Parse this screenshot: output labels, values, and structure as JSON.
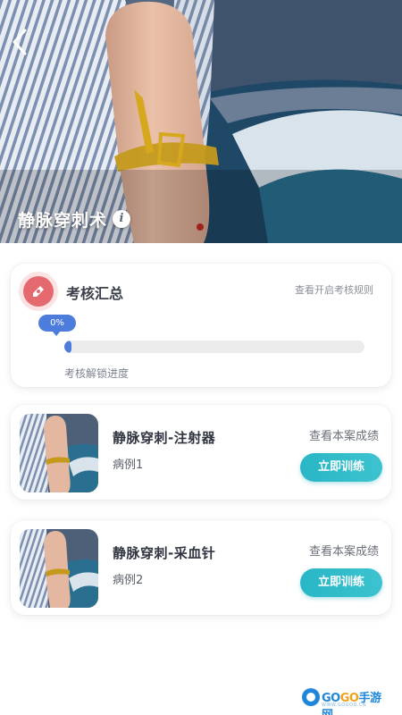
{
  "hero": {
    "title": "静脉穿刺术",
    "back_icon": "chevron-left-icon",
    "info_icon": "info-icon",
    "info_glyph": "i"
  },
  "summary": {
    "title": "考核汇总",
    "rules_link": "查看开启考核规则",
    "icon": "pencil-badge-icon",
    "progress_value": 0,
    "progress_text": "0%",
    "progress_label": "考核解锁进度"
  },
  "cases": [
    {
      "title": "静脉穿刺-注射器",
      "subtitle": "病例1",
      "link": "查看本案成绩",
      "button": "立即训练"
    },
    {
      "title": "静脉穿刺-采血针",
      "subtitle": "病例2",
      "link": "查看本案成绩",
      "button": "立即训练"
    }
  ],
  "watermark": {
    "brand_a": "GO",
    "brand_b": "GO",
    "brand_c": "手游网",
    "url": "WWW.GOGOD.CN"
  },
  "colors": {
    "accent_blue": "#4d7ddc",
    "accent_teal": "#29b6c6",
    "summary_icon": "#e46a70"
  }
}
